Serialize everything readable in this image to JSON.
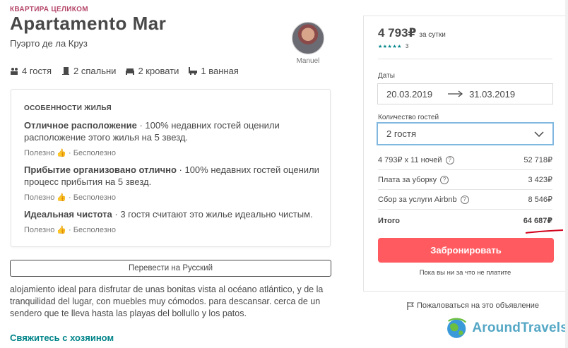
{
  "listing": {
    "type_tag": "КВАРТИРА ЦЕЛИКОМ",
    "title": "Apartamento Mar",
    "location": "Пуэрто де ла Круз",
    "host_name": "Manuel"
  },
  "specs": [
    {
      "icon": "guests-icon",
      "label": "4 гостя"
    },
    {
      "icon": "door-icon",
      "label": "2 спальни"
    },
    {
      "icon": "bed-icon",
      "label": "2 кровати"
    },
    {
      "icon": "bath-icon",
      "label": "1 ванная"
    }
  ],
  "highlights": {
    "heading": "ОСОБЕННОСТИ ЖИЛЬЯ",
    "items": [
      {
        "title": "Отличное расположение",
        "text": " · 100% недавних гостей оценили расположение этого жилья на 5 звезд."
      },
      {
        "title": "Прибытие организовано отлично",
        "text": " · 100% недавних гостей оценили процесс прибытия на 5 звезд."
      },
      {
        "title": "Идеальная чистота",
        "text": " · 3 гостя считают это жилье идеально чистым."
      }
    ],
    "vote_useful": "Полезно",
    "vote_useless": " · Бесполезно"
  },
  "translate_button": "Перевести на Русский",
  "description": "alojamiento ideal para disfrutar de unas bonitas vista al océano atlántico, y de la tranquilidad del lugar, con muebles muy cómodos. para descansar. cerca de un sendero que te lleva hasta las playas del bollullo y los patos.",
  "contact_host": "Свяжитесь с хозяином",
  "booking": {
    "price": "4 793₽",
    "price_unit": "за сутки",
    "stars": "★★★★★",
    "review_count": "3",
    "dates_label": "Даты",
    "check_in": "20.03.2019",
    "check_out": "31.03.2019",
    "guests_label": "Количество гостей",
    "guests_value": "2 гостя",
    "rows": [
      {
        "label": "4 793₽ x 11 ночей",
        "value": "52 718₽"
      },
      {
        "label": "Плата за уборку",
        "value": "3 423₽"
      },
      {
        "label": "Сбор за услуги Airbnb",
        "value": "8 546₽"
      }
    ],
    "total_label": "Итого",
    "total_value": "64 687₽",
    "book_button": "Забронировать",
    "no_charge_note": "Пока вы ни за что не платите",
    "report_text": "Пожаловаться на это объявление"
  },
  "watermark": {
    "text": "AroundTravels"
  },
  "colors": {
    "accent": "#ff5a5f",
    "teal": "#008489",
    "tag": "#b4476a",
    "focus_border": "#80b8e0",
    "annotation_red": "#d0021b"
  }
}
